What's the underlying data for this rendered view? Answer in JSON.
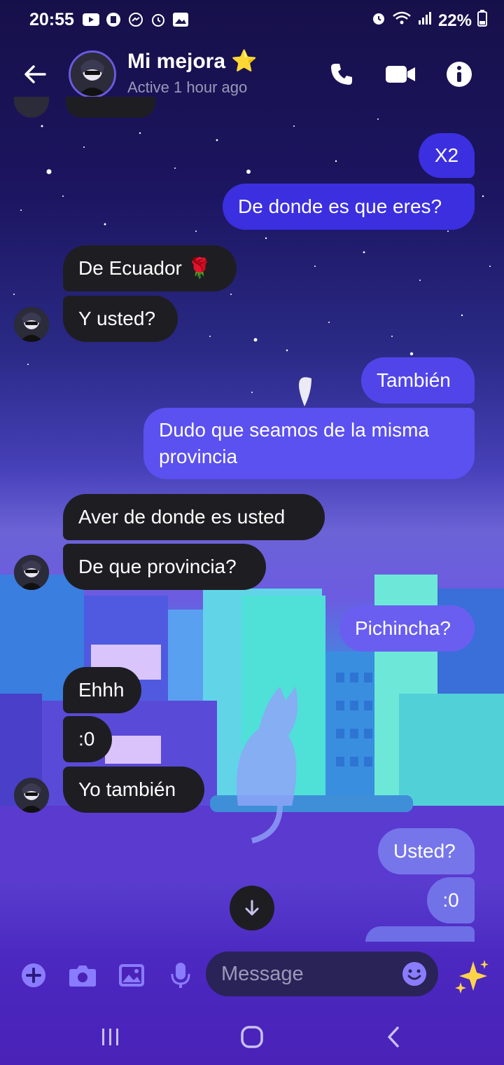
{
  "status_bar": {
    "time": "20:55",
    "battery": "22%",
    "left_icons": [
      "youtube-icon",
      "app-icon",
      "messenger-icon",
      "alarm-icon",
      "gallery-icon"
    ],
    "right_icons": [
      "alarm-icon",
      "wifi-icon",
      "signal-icon",
      "battery-icon"
    ]
  },
  "header": {
    "contact_name": "Mi mejora ⭐",
    "contact_status": "Active 1 hour ago"
  },
  "messages": [
    {
      "from": "me",
      "text": "X2"
    },
    {
      "from": "me",
      "text": "De donde es que eres?"
    },
    {
      "from": "them",
      "text": "De Ecuador 🌹"
    },
    {
      "from": "them",
      "text": "Y usted?"
    },
    {
      "from": "me",
      "text": "También"
    },
    {
      "from": "me",
      "text": "Dudo que seamos de la misma provincia"
    },
    {
      "from": "them",
      "text": "Aver de donde es usted"
    },
    {
      "from": "them",
      "text": "De que provincia?"
    },
    {
      "from": "me",
      "text": "Pichincha?"
    },
    {
      "from": "them",
      "text": "Ehhh"
    },
    {
      "from": "them",
      "text": ":0"
    },
    {
      "from": "them",
      "text": "Yo también"
    },
    {
      "from": "me",
      "text": "Usted?"
    },
    {
      "from": "me",
      "text": ":0"
    }
  ],
  "composer": {
    "placeholder": "Message"
  },
  "colors": {
    "outgoing_bubble": "#4a3fe0",
    "incoming_bubble": "#1e1e22",
    "accent": "#8a7cff"
  }
}
